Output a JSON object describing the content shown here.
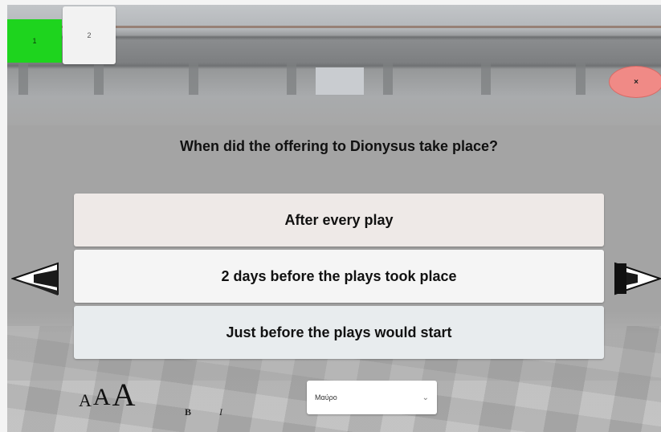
{
  "tabs": [
    {
      "label": "1",
      "state": "completed",
      "color": "#1ed41e"
    },
    {
      "label": "2",
      "state": "current"
    }
  ],
  "close_button": {
    "label": "×",
    "color": "#f08a86"
  },
  "question": "When did the offering to Dionysus take place?",
  "answers": [
    "After every play",
    "2 days before the plays took place",
    "Just before the plays would start"
  ],
  "navigation": {
    "prev_icon": "arrow-left-icon",
    "next_icon": "arrow-right-icon"
  },
  "font_size_options": [
    "A",
    "A",
    "A"
  ],
  "format_buttons": {
    "bold": "B",
    "italic": "I"
  },
  "color_select": {
    "value": "Μαύρο"
  }
}
